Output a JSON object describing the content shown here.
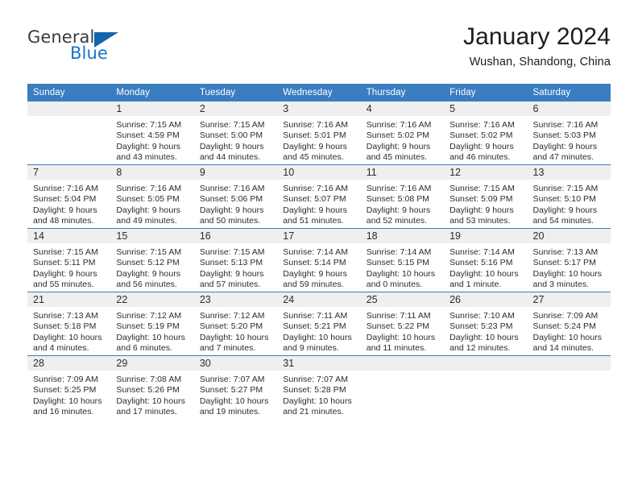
{
  "brand": {
    "name_top": "General",
    "name_bottom": "Blue"
  },
  "header": {
    "title": "January 2024",
    "subtitle": "Wushan, Shandong, China"
  },
  "colors": {
    "header_blue": "#3a7dc0",
    "brand_blue": "#1876c8",
    "daynum_band": "#efefef"
  },
  "weekdays": [
    "Sunday",
    "Monday",
    "Tuesday",
    "Wednesday",
    "Thursday",
    "Friday",
    "Saturday"
  ],
  "weeks": [
    [
      {
        "day": "",
        "lines": []
      },
      {
        "day": "1",
        "lines": [
          "Sunrise: 7:15 AM",
          "Sunset: 4:59 PM",
          "Daylight: 9 hours",
          "and 43 minutes."
        ]
      },
      {
        "day": "2",
        "lines": [
          "Sunrise: 7:15 AM",
          "Sunset: 5:00 PM",
          "Daylight: 9 hours",
          "and 44 minutes."
        ]
      },
      {
        "day": "3",
        "lines": [
          "Sunrise: 7:16 AM",
          "Sunset: 5:01 PM",
          "Daylight: 9 hours",
          "and 45 minutes."
        ]
      },
      {
        "day": "4",
        "lines": [
          "Sunrise: 7:16 AM",
          "Sunset: 5:02 PM",
          "Daylight: 9 hours",
          "and 45 minutes."
        ]
      },
      {
        "day": "5",
        "lines": [
          "Sunrise: 7:16 AM",
          "Sunset: 5:02 PM",
          "Daylight: 9 hours",
          "and 46 minutes."
        ]
      },
      {
        "day": "6",
        "lines": [
          "Sunrise: 7:16 AM",
          "Sunset: 5:03 PM",
          "Daylight: 9 hours",
          "and 47 minutes."
        ]
      }
    ],
    [
      {
        "day": "7",
        "lines": [
          "Sunrise: 7:16 AM",
          "Sunset: 5:04 PM",
          "Daylight: 9 hours",
          "and 48 minutes."
        ]
      },
      {
        "day": "8",
        "lines": [
          "Sunrise: 7:16 AM",
          "Sunset: 5:05 PM",
          "Daylight: 9 hours",
          "and 49 minutes."
        ]
      },
      {
        "day": "9",
        "lines": [
          "Sunrise: 7:16 AM",
          "Sunset: 5:06 PM",
          "Daylight: 9 hours",
          "and 50 minutes."
        ]
      },
      {
        "day": "10",
        "lines": [
          "Sunrise: 7:16 AM",
          "Sunset: 5:07 PM",
          "Daylight: 9 hours",
          "and 51 minutes."
        ]
      },
      {
        "day": "11",
        "lines": [
          "Sunrise: 7:16 AM",
          "Sunset: 5:08 PM",
          "Daylight: 9 hours",
          "and 52 minutes."
        ]
      },
      {
        "day": "12",
        "lines": [
          "Sunrise: 7:15 AM",
          "Sunset: 5:09 PM",
          "Daylight: 9 hours",
          "and 53 minutes."
        ]
      },
      {
        "day": "13",
        "lines": [
          "Sunrise: 7:15 AM",
          "Sunset: 5:10 PM",
          "Daylight: 9 hours",
          "and 54 minutes."
        ]
      }
    ],
    [
      {
        "day": "14",
        "lines": [
          "Sunrise: 7:15 AM",
          "Sunset: 5:11 PM",
          "Daylight: 9 hours",
          "and 55 minutes."
        ]
      },
      {
        "day": "15",
        "lines": [
          "Sunrise: 7:15 AM",
          "Sunset: 5:12 PM",
          "Daylight: 9 hours",
          "and 56 minutes."
        ]
      },
      {
        "day": "16",
        "lines": [
          "Sunrise: 7:15 AM",
          "Sunset: 5:13 PM",
          "Daylight: 9 hours",
          "and 57 minutes."
        ]
      },
      {
        "day": "17",
        "lines": [
          "Sunrise: 7:14 AM",
          "Sunset: 5:14 PM",
          "Daylight: 9 hours",
          "and 59 minutes."
        ]
      },
      {
        "day": "18",
        "lines": [
          "Sunrise: 7:14 AM",
          "Sunset: 5:15 PM",
          "Daylight: 10 hours",
          "and 0 minutes."
        ]
      },
      {
        "day": "19",
        "lines": [
          "Sunrise: 7:14 AM",
          "Sunset: 5:16 PM",
          "Daylight: 10 hours",
          "and 1 minute."
        ]
      },
      {
        "day": "20",
        "lines": [
          "Sunrise: 7:13 AM",
          "Sunset: 5:17 PM",
          "Daylight: 10 hours",
          "and 3 minutes."
        ]
      }
    ],
    [
      {
        "day": "21",
        "lines": [
          "Sunrise: 7:13 AM",
          "Sunset: 5:18 PM",
          "Daylight: 10 hours",
          "and 4 minutes."
        ]
      },
      {
        "day": "22",
        "lines": [
          "Sunrise: 7:12 AM",
          "Sunset: 5:19 PM",
          "Daylight: 10 hours",
          "and 6 minutes."
        ]
      },
      {
        "day": "23",
        "lines": [
          "Sunrise: 7:12 AM",
          "Sunset: 5:20 PM",
          "Daylight: 10 hours",
          "and 7 minutes."
        ]
      },
      {
        "day": "24",
        "lines": [
          "Sunrise: 7:11 AM",
          "Sunset: 5:21 PM",
          "Daylight: 10 hours",
          "and 9 minutes."
        ]
      },
      {
        "day": "25",
        "lines": [
          "Sunrise: 7:11 AM",
          "Sunset: 5:22 PM",
          "Daylight: 10 hours",
          "and 11 minutes."
        ]
      },
      {
        "day": "26",
        "lines": [
          "Sunrise: 7:10 AM",
          "Sunset: 5:23 PM",
          "Daylight: 10 hours",
          "and 12 minutes."
        ]
      },
      {
        "day": "27",
        "lines": [
          "Sunrise: 7:09 AM",
          "Sunset: 5:24 PM",
          "Daylight: 10 hours",
          "and 14 minutes."
        ]
      }
    ],
    [
      {
        "day": "28",
        "lines": [
          "Sunrise: 7:09 AM",
          "Sunset: 5:25 PM",
          "Daylight: 10 hours",
          "and 16 minutes."
        ]
      },
      {
        "day": "29",
        "lines": [
          "Sunrise: 7:08 AM",
          "Sunset: 5:26 PM",
          "Daylight: 10 hours",
          "and 17 minutes."
        ]
      },
      {
        "day": "30",
        "lines": [
          "Sunrise: 7:07 AM",
          "Sunset: 5:27 PM",
          "Daylight: 10 hours",
          "and 19 minutes."
        ]
      },
      {
        "day": "31",
        "lines": [
          "Sunrise: 7:07 AM",
          "Sunset: 5:28 PM",
          "Daylight: 10 hours",
          "and 21 minutes."
        ]
      },
      {
        "day": "",
        "lines": []
      },
      {
        "day": "",
        "lines": []
      },
      {
        "day": "",
        "lines": []
      }
    ]
  ]
}
